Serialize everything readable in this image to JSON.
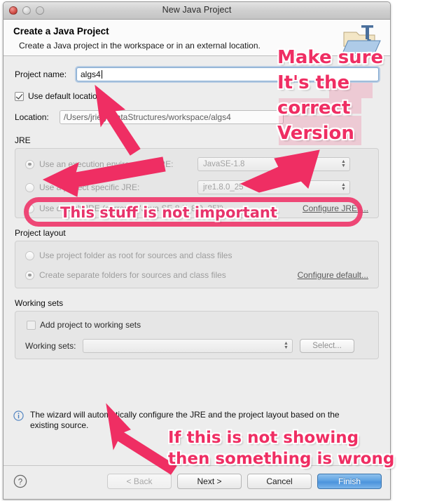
{
  "window": {
    "title": "New Java Project",
    "traffic_lights": [
      "close",
      "minimize",
      "zoom"
    ]
  },
  "header": {
    "title": "Create a Java Project",
    "subtitle": "Create a Java project in the workspace or in an external location.",
    "icon": "java-project-folder-icon"
  },
  "form": {
    "project_name_label": "Project name:",
    "project_name_value": "algs4",
    "use_default_location_label": "Use default location",
    "use_default_location_checked": true,
    "location_label": "Location:",
    "location_value": "/Users/jriely/DataStructures/workspace/algs4"
  },
  "jre": {
    "group_label": "JRE",
    "option_execution_env": "Use an execution environment JRE:",
    "option_project_specific": "Use a project specific JRE:",
    "option_default": "Use default JRE (currently 'Java SE 8 [1.8.0_25]')",
    "execution_env_value": "JavaSE-1.8",
    "project_specific_value": "jre1.8.0_25",
    "configure_link": "Configure JREs...",
    "selected": "execution_env"
  },
  "project_layout": {
    "group_label": "Project layout",
    "option_root": "Use project folder as root for sources and class files",
    "option_separate": "Create separate folders for sources and class files",
    "configure_link": "Configure default...",
    "selected": "separate"
  },
  "working_sets": {
    "group_label": "Working sets",
    "add_checkbox_label": "Add project to working sets",
    "add_checked": false,
    "working_sets_label": "Working sets:",
    "working_sets_value": "",
    "select_button": "Select..."
  },
  "info": {
    "icon": "info-icon",
    "line1": "The wizard will automatically configure the JRE and the project layout based on the",
    "line2": "existing source."
  },
  "buttons": {
    "help": "?",
    "back": "< Back",
    "next": "Next >",
    "cancel": "Cancel",
    "finish": "Finish"
  },
  "annotations": {
    "color": "#ef2e63",
    "top_line1": "Make sure",
    "top_line2": "It's the",
    "top_line3": "correct",
    "top_line4": "Version",
    "oval_text": "This stuff is not important",
    "bottom_line1": "If this is not showing",
    "bottom_line2": "then something is wrong",
    "arrows": [
      "arrow-to-project-name",
      "arrow-to-jre-radio",
      "arrow-to-jre-version",
      "arrow-to-info-message"
    ]
  }
}
